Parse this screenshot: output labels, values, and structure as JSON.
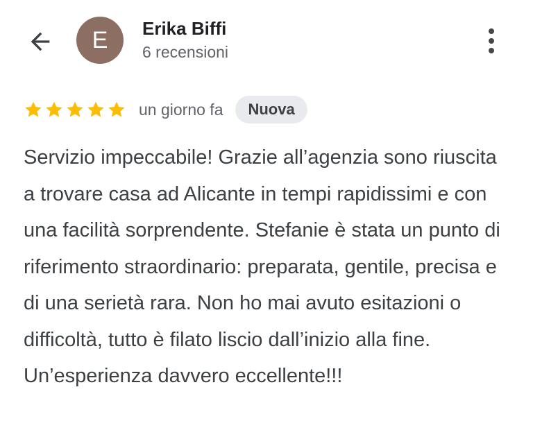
{
  "header": {
    "back_icon": "arrow-left-icon",
    "avatar_letter": "E",
    "avatar_color": "#8d6e63",
    "author_name": "Erika Biffi",
    "author_meta": "6 recensioni",
    "more_icon": "more-vert-icon"
  },
  "review": {
    "rating": 5,
    "rating_max": 5,
    "star_color": "#fbbc04",
    "date": "un giorno fa",
    "badge": "Nuova",
    "text": "Servizio impeccabile! Grazie all’agenzia sono riuscita a trovare casa ad Alicante in tempi rapidissimi e con una facilità sorprendente. Stefanie è stata un punto di riferimento straordinario: preparata, gentile, precisa e di una serietà rara. Non ho mai avuto esitazioni o difficoltà, tutto è filato liscio dall’inizio alla fine. Un’esperienza davvero eccellente!!!"
  }
}
